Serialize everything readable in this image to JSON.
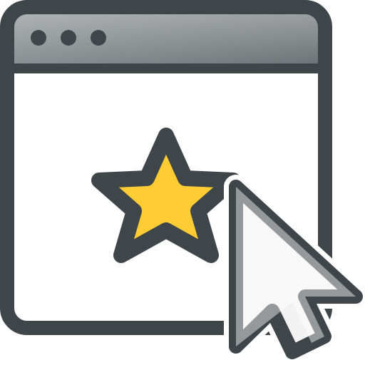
{
  "icon": {
    "name": "favorite-webpage-icon",
    "elements": [
      "browser-window-icon",
      "star-icon",
      "mouse-cursor-icon"
    ]
  },
  "window": {
    "controls": [
      "dot",
      "dot",
      "dot"
    ]
  },
  "colors": {
    "outline": "#3f4649",
    "titlebar_fill": "#7b8184",
    "titlebar_highlight": "#b2b7b9",
    "window_fill": "#ffffff",
    "star_fill": "#ffcc33",
    "cursor_fill": "#f2f2f2",
    "dot_fill": "#3f4649"
  }
}
